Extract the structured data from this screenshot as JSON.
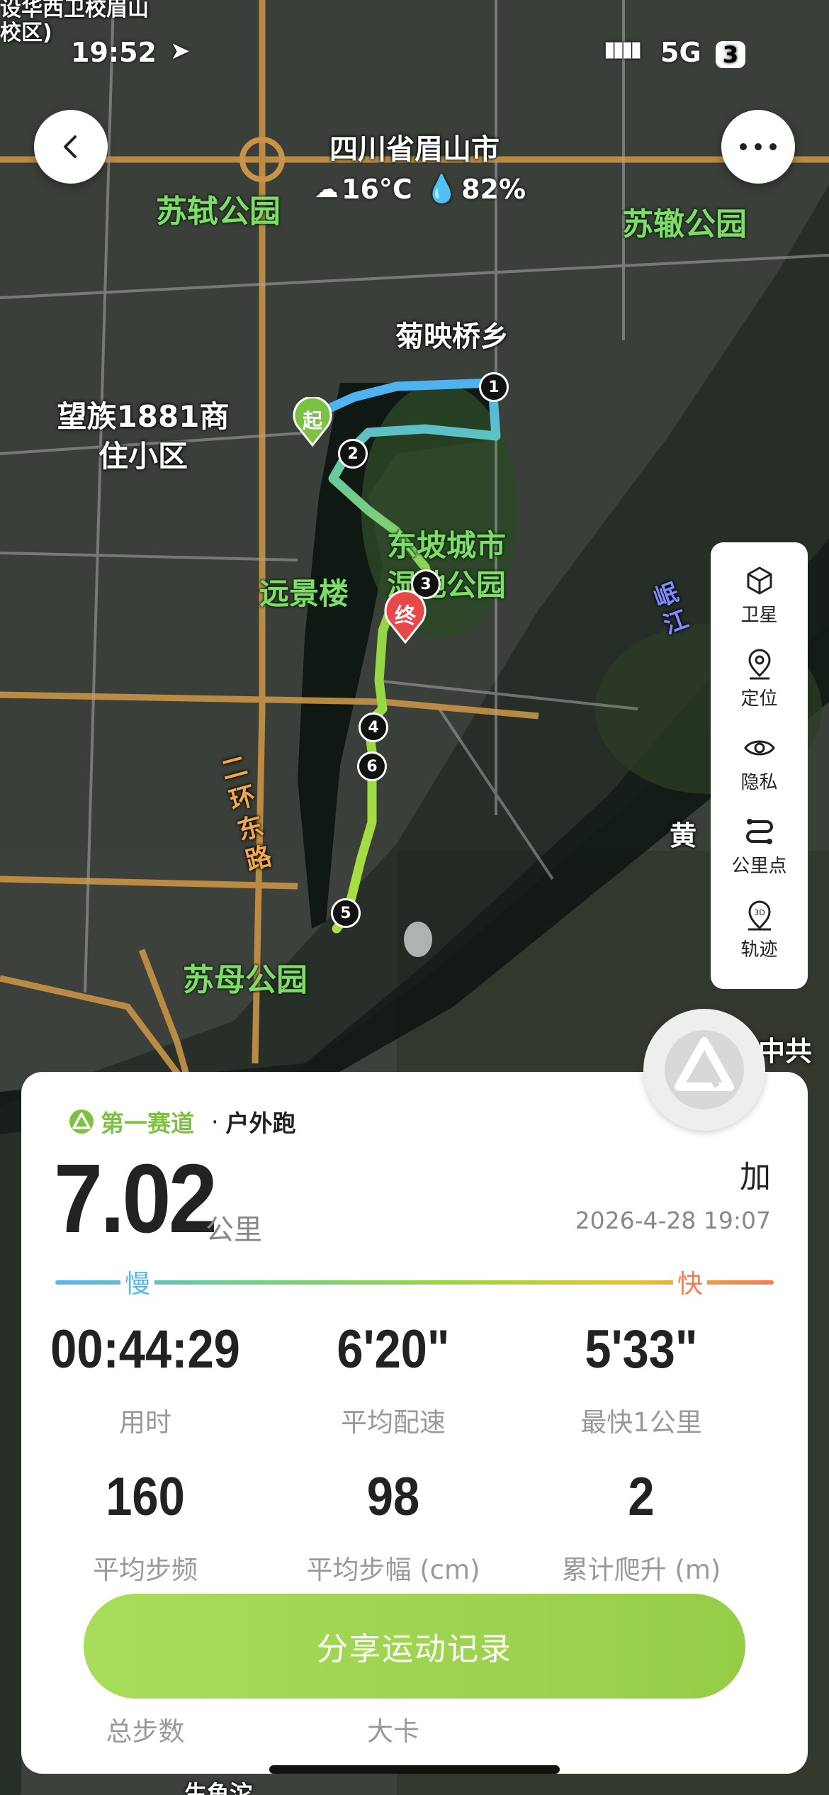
{
  "status_bar": {
    "time": "19:52",
    "network": "5G",
    "battery": "3"
  },
  "header": {
    "city": "四川省眉山市",
    "temperature": "16°C",
    "humidity": "82%"
  },
  "map_labels": {
    "top_left_fragment": "设华西卫校眉山校区)",
    "su_shi_park": "苏轼公园",
    "su_zhe_park": "苏辙公园",
    "juying_bridge": "菊映桥乡",
    "wangzu": "望族1881商住小区",
    "yuanjing": "远景楼",
    "dongpo_wetland": "东坡城市湿地公园",
    "river": "岷江",
    "ring_road": "二环东路",
    "sumu_park": "苏母公园",
    "huang": "黄",
    "right_fragment": "中共",
    "bottom_fragment": "生鱼沱"
  },
  "route_markers": {
    "start": "起",
    "end": "终",
    "km": [
      "1",
      "2",
      "3",
      "4",
      "6",
      "5"
    ]
  },
  "tools": [
    {
      "icon": "satellite-cube-icon",
      "label": "卫星"
    },
    {
      "icon": "location-pin-icon",
      "label": "定位"
    },
    {
      "icon": "eye-icon",
      "label": "隐私"
    },
    {
      "icon": "km-points-icon",
      "label": "公里点"
    },
    {
      "icon": "3d-track-icon",
      "label": "轨迹"
    }
  ],
  "summary": {
    "brand": "第一赛道",
    "activity": "户外跑",
    "distance": "7.02",
    "distance_unit": "公里",
    "plus": "加",
    "datetime": "2026-4-28 19:07",
    "slow": "慢",
    "fast": "快",
    "stats": [
      {
        "value": "00:44:29",
        "label": "用时"
      },
      {
        "value": "6'20\"",
        "label": "平均配速"
      },
      {
        "value": "5'33\"",
        "label": "最快1公里"
      },
      {
        "value": "160",
        "label": "平均步频"
      },
      {
        "value": "98",
        "label": "平均步幅 (cm)"
      },
      {
        "value": "2",
        "label": "累计爬升 (m)"
      }
    ],
    "hidden_labels": [
      "总步数",
      "大卡"
    ],
    "share_button": "分享运动记录"
  },
  "colors": {
    "brand_green": "#7cc242",
    "route_start": "#4fb3f2",
    "route_end": "#a8e040",
    "end_pin": "#e84848"
  }
}
